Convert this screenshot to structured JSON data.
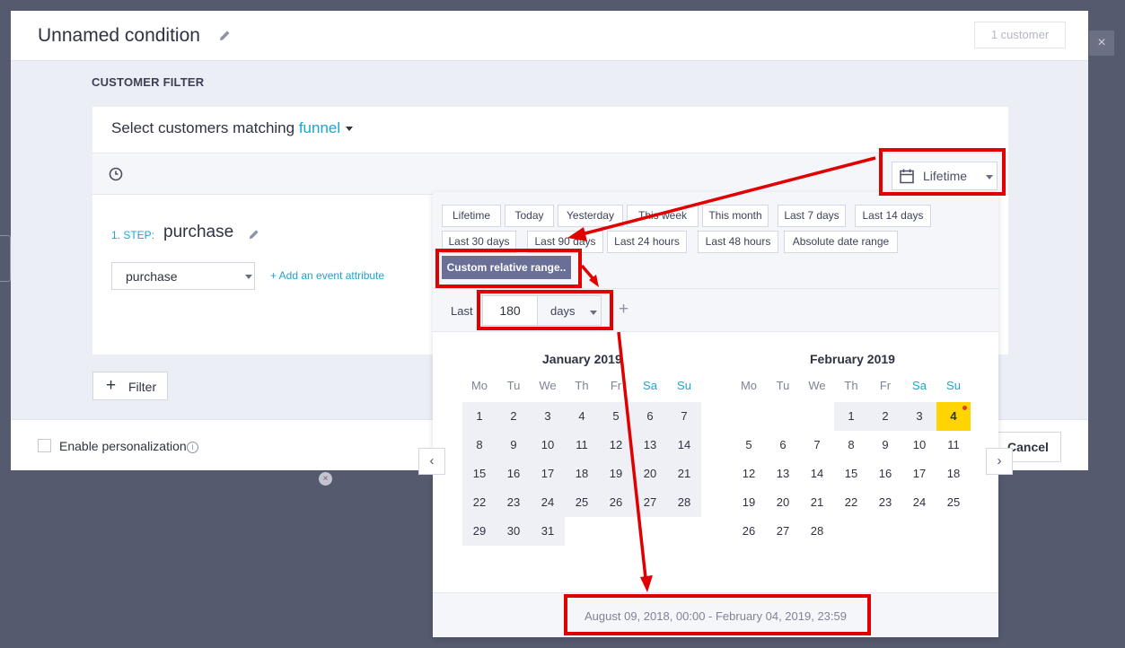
{
  "background": {
    "close_glyph": "×",
    "remove_glyph": "×"
  },
  "modal": {
    "title": "Unnamed condition",
    "customer_count": "1 customer",
    "section_heading": "CUSTOMER FILTER",
    "match_prefix": "Select customers matching",
    "match_type": "funnel",
    "time_filter_label": "Lifetime",
    "step": {
      "label": "1. STEP:",
      "name": "purchase",
      "event": "purchase",
      "add_attribute": "+ Add an event attribute"
    },
    "add_filter_label": "Filter",
    "add_filter_icon": "+",
    "personalization_label": "Enable personalization",
    "info_glyph": "i",
    "cancel_label": "Cancel"
  },
  "date_picker": {
    "presets": [
      "Lifetime",
      "Today",
      "Yesterday",
      "This week",
      "This month",
      "Last 7 days",
      "Last 14 days",
      "Last 30 days",
      "Last 90 days",
      "Last 24 hours",
      "Last 48 hours",
      "Absolute date range"
    ],
    "custom_label": "Custom relative range..",
    "last_label": "Last",
    "amount": "180",
    "unit": "days",
    "add_glyph": "+",
    "prev_glyph": "‹",
    "next_glyph": "›",
    "weekdays": [
      "Mo",
      "Tu",
      "We",
      "Th",
      "Fr",
      "Sa",
      "Su"
    ],
    "months": [
      {
        "title": "January 2019",
        "first_weekday": 1,
        "days": 31,
        "range_from": 1,
        "range_to": 31,
        "today": null
      },
      {
        "title": "February 2019",
        "first_weekday": 4,
        "days": 28,
        "range_from": 1,
        "range_to": 4,
        "today": 4
      }
    ],
    "selected_range": "August 09, 2018, 00:00 - February 04, 2019, 23:59"
  },
  "colors": {
    "accent": "#1aa5d4",
    "annotation": "#e00000",
    "active_preset": "#6a6f97",
    "today": "#ffd400"
  }
}
